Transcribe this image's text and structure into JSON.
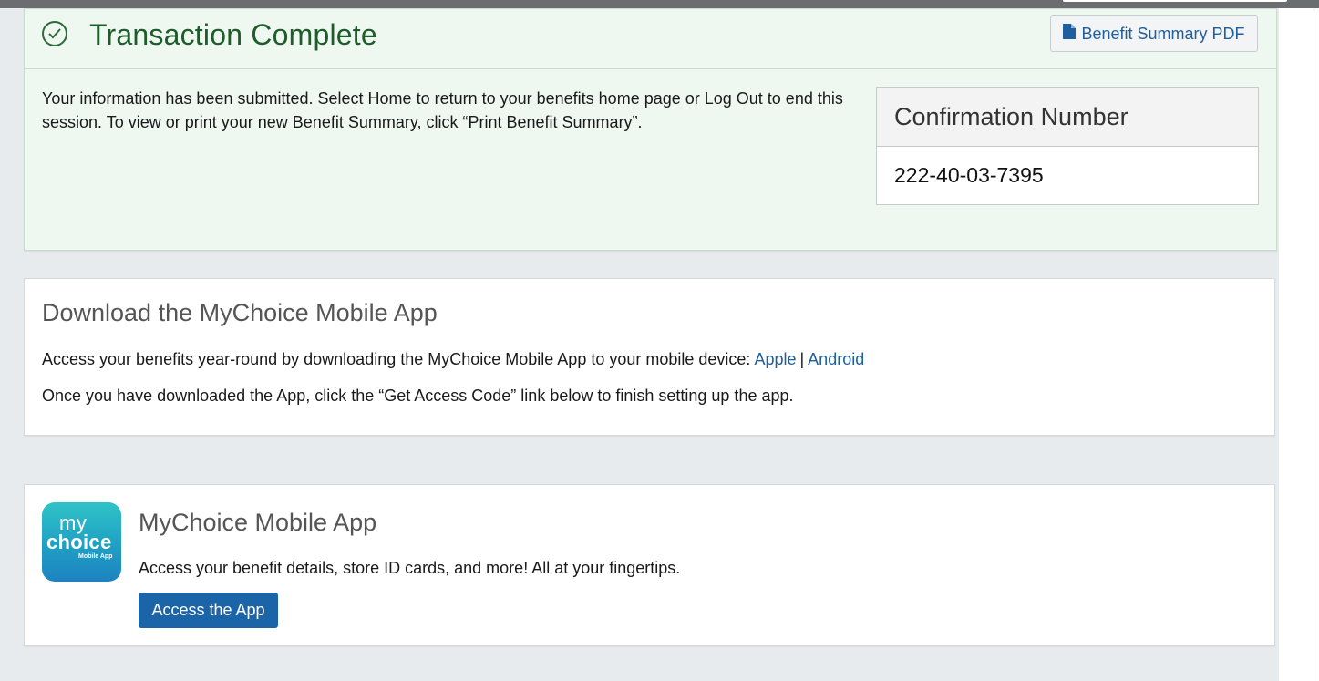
{
  "transaction": {
    "title": "Transaction Complete",
    "pdf_button": "Benefit Summary PDF",
    "message": "Your information has been submitted. Select Home to return to your benefits home page or Log Out to end this session. To view or print your new Benefit Summary, click “Print Benefit Summary”.",
    "confirmation_label": "Confirmation Number",
    "confirmation_number": "222-40-03-7395"
  },
  "download": {
    "title": "Download the MyChoice Mobile App",
    "line1_text": "Access your benefits year-round by downloading the MyChoice Mobile App to your mobile device: ",
    "apple_link": "Apple",
    "separator": "|",
    "android_link": "Android",
    "line2_text": "Once you have downloaded the App, click the “Get Access Code” link below to finish setting up the app."
  },
  "app": {
    "logo_my": "my",
    "logo_choice": "choice",
    "logo_sub": "Mobile App",
    "title": "MyChoice Mobile App",
    "description": "Access your benefit details, store ID cards, and more! All at your fingertips.",
    "button": "Access the App"
  },
  "colors": {
    "success_green": "#1f5c2b",
    "link_blue": "#1f5f9e",
    "primary_button": "#1c64a8"
  },
  "icons": {
    "success": "check-circle-icon",
    "pdf": "file-icon"
  }
}
